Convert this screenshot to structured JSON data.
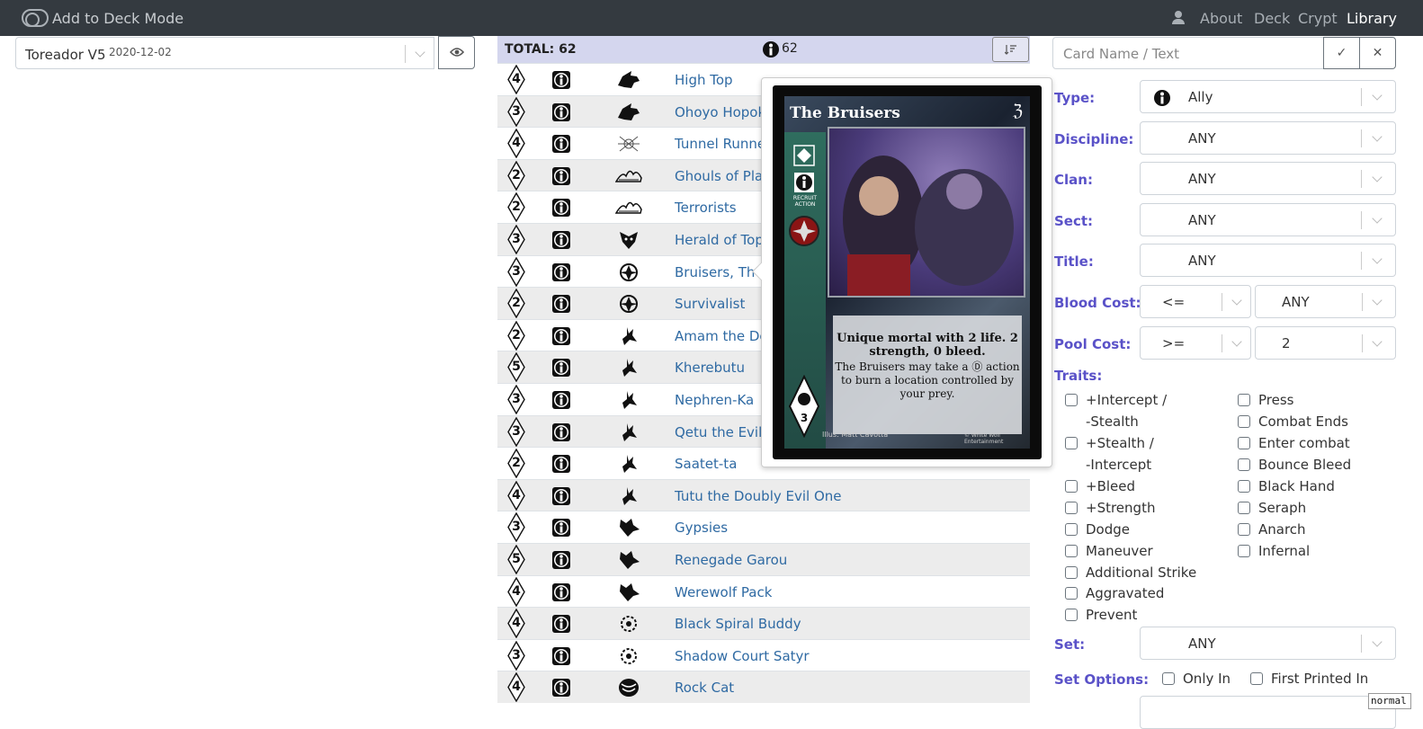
{
  "topbar": {
    "mode_label": "Add to Deck Mode",
    "nav": [
      "About",
      "Deck",
      "Crypt",
      "Library"
    ],
    "active_nav": "Library"
  },
  "deck": {
    "name": "Toreador V5",
    "date": "2020-12-02"
  },
  "table": {
    "total_label": "TOTAL: 62",
    "type_count": "62",
    "rows": [
      {
        "cost": "4",
        "clan_icon": "wolf-icon",
        "name": "High Top"
      },
      {
        "cost": "3",
        "clan_icon": "wolf-icon",
        "name": "Ohoyo Hopok"
      },
      {
        "cost": "4",
        "clan_icon": "spider-icon",
        "name": "Tunnel Runne"
      },
      {
        "cost": "2",
        "clan_icon": "ghoul-icon",
        "name": "Ghouls of Plaz"
      },
      {
        "cost": "2",
        "clan_icon": "ghoul-icon",
        "name": "Terrorists"
      },
      {
        "cost": "3",
        "clan_icon": "hooded-icon",
        "name": "Herald of Topl"
      },
      {
        "cost": "3",
        "clan_icon": "sigil-icon",
        "name": "Bruisers, The"
      },
      {
        "cost": "2",
        "clan_icon": "sigil-icon",
        "name": "Survivalist"
      },
      {
        "cost": "2",
        "clan_icon": "jackal-icon",
        "name": "Amam the De"
      },
      {
        "cost": "5",
        "clan_icon": "jackal-icon",
        "name": "Kherebutu"
      },
      {
        "cost": "3",
        "clan_icon": "jackal-icon",
        "name": "Nephren-Ka"
      },
      {
        "cost": "3",
        "clan_icon": "jackal-icon",
        "name": "Qetu the Evil I"
      },
      {
        "cost": "2",
        "clan_icon": "jackal-icon",
        "name": "Saatet-ta"
      },
      {
        "cost": "4",
        "clan_icon": "jackal-icon",
        "name": "Tutu the Doubly Evil One"
      },
      {
        "cost": "3",
        "clan_icon": "wolf-head-icon",
        "name": "Gypsies"
      },
      {
        "cost": "5",
        "clan_icon": "wolf-head-icon",
        "name": "Renegade Garou"
      },
      {
        "cost": "4",
        "clan_icon": "wolf-head-icon",
        "name": "Werewolf Pack"
      },
      {
        "cost": "4",
        "clan_icon": "spiral-icon",
        "name": "Black Spiral Buddy"
      },
      {
        "cost": "3",
        "clan_icon": "spiral-icon",
        "name": "Shadow Court Satyr"
      },
      {
        "cost": "4",
        "clan_icon": "claw-icon",
        "name": "Rock Cat"
      }
    ]
  },
  "card_popup": {
    "title": "The Bruisers",
    "cost": "3",
    "text_bold": "Unique mortal with 2 life. 2 strength, 0 bleed.",
    "text_body": "The Bruisers may take a Ⓓ action to burn a location controlled by your prey.",
    "side_label": "RECRUIT ACTION",
    "illustrator": "Illus: Matt Cavotta",
    "copyright": "© White Wolf Entertainment",
    "pool_cost": "3"
  },
  "filters": {
    "search_placeholder": "Card Name / Text",
    "type_label": "Type:",
    "type_value": "Ally",
    "discipline_label": "Discipline:",
    "discipline_value": "ANY",
    "clan_label": "Clan:",
    "clan_value": "ANY",
    "sect_label": "Sect:",
    "sect_value": "ANY",
    "title_label": "Title:",
    "title_value": "ANY",
    "blood_label": "Blood Cost:",
    "blood_op": "<=",
    "blood_value": "ANY",
    "pool_label": "Pool Cost:",
    "pool_op": ">=",
    "pool_value": "2",
    "traits_label": "Traits:",
    "traits_left": [
      "+Intercept /",
      "-Stealth",
      "+Stealth /",
      "-Intercept",
      "+Bleed",
      "+Strength",
      "Dodge",
      "Maneuver",
      "Additional Strike",
      "Aggravated",
      "Prevent"
    ],
    "traits_right": [
      "Press",
      "Combat Ends",
      "Enter combat",
      "Bounce Bleed",
      "Black Hand",
      "Seraph",
      "Anarch",
      "Infernal"
    ],
    "set_label": "Set:",
    "set_value": "ANY",
    "set_options_label": "Set Options:",
    "only_in": "Only In",
    "first_printed": "First Printed In"
  },
  "corner_tag": "normal"
}
